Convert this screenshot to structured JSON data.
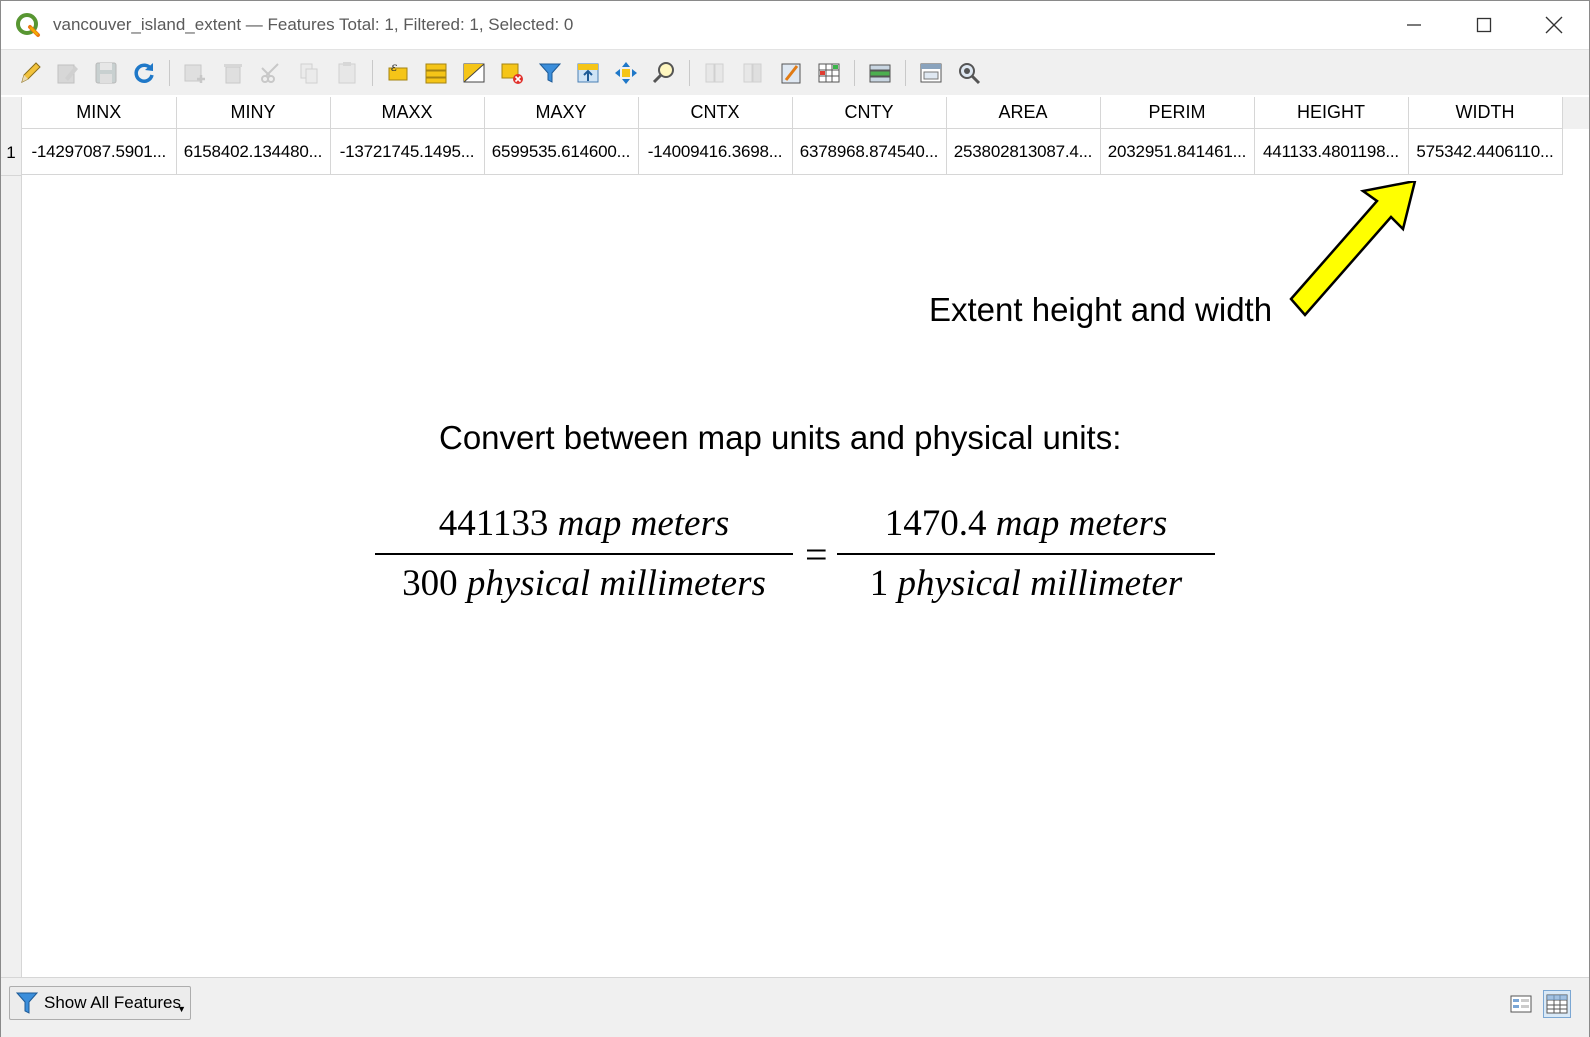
{
  "window": {
    "title": "vancouver_island_extent — Features Total: 1, Filtered: 1, Selected: 0"
  },
  "toolbar": {
    "buttons": [
      {
        "icon": "pencil-edit-icon",
        "enabled": true
      },
      {
        "icon": "multi-edit-icon",
        "enabled": false
      },
      {
        "icon": "save-edits-icon",
        "enabled": false
      },
      {
        "icon": "reload-icon",
        "enabled": true
      },
      {
        "icon": "add-feature-icon",
        "enabled": false
      },
      {
        "icon": "delete-feature-icon",
        "enabled": false
      },
      {
        "icon": "cut-icon",
        "enabled": false
      },
      {
        "icon": "copy-icon",
        "enabled": false
      },
      {
        "icon": "paste-icon",
        "enabled": false
      },
      {
        "icon": "select-expression-icon",
        "enabled": true
      },
      {
        "icon": "select-all-icon",
        "enabled": true
      },
      {
        "icon": "invert-selection-icon",
        "enabled": true
      },
      {
        "icon": "deselect-icon",
        "enabled": true
      },
      {
        "icon": "filter-icon",
        "enabled": true
      },
      {
        "icon": "move-to-top-icon",
        "enabled": true
      },
      {
        "icon": "pan-to-selection-icon",
        "enabled": true
      },
      {
        "icon": "zoom-to-selection-icon",
        "enabled": true
      },
      {
        "icon": "new-field-icon",
        "enabled": false
      },
      {
        "icon": "delete-field-icon",
        "enabled": false
      },
      {
        "icon": "field-calculator-icon",
        "enabled": true
      },
      {
        "icon": "conditional-formatting-icon",
        "enabled": true
      },
      {
        "icon": "organize-columns-icon",
        "enabled": true
      },
      {
        "icon": "dock-icon",
        "enabled": true
      },
      {
        "icon": "actions-icon",
        "enabled": true
      }
    ]
  },
  "table": {
    "columns": [
      "MINX",
      "MINY",
      "MAXX",
      "MAXY",
      "CNTX",
      "CNTY",
      "AREA",
      "PERIM",
      "HEIGHT",
      "WIDTH"
    ],
    "rows": [
      {
        "num": "1",
        "cells": [
          "-14297087.5901...",
          "6158402.134480...",
          "-13721745.1495...",
          "6599535.614600...",
          "-14009416.3698...",
          "6378968.874540...",
          "253802813087.4...",
          "2032951.841461...",
          "441133.4801198...",
          "575342.4406110..."
        ]
      }
    ]
  },
  "annotation": {
    "arrow_color": "#ffff00",
    "label": "Extent height and width",
    "convert_title": "Convert between map units and physical units:",
    "equation": {
      "left_num_value": "441133",
      "left_num_units": "map meters",
      "left_den_value": "300",
      "left_den_units": "physical millimeters",
      "equals": "=",
      "right_num_value": "1470.4",
      "right_num_units": "map meters",
      "right_den_value": "1",
      "right_den_units": "physical millimeter"
    }
  },
  "statusbar": {
    "show_all_label": "Show All Features",
    "view_buttons": [
      {
        "icon": "form-view-icon",
        "active": false
      },
      {
        "icon": "table-view-icon",
        "active": true
      }
    ]
  }
}
